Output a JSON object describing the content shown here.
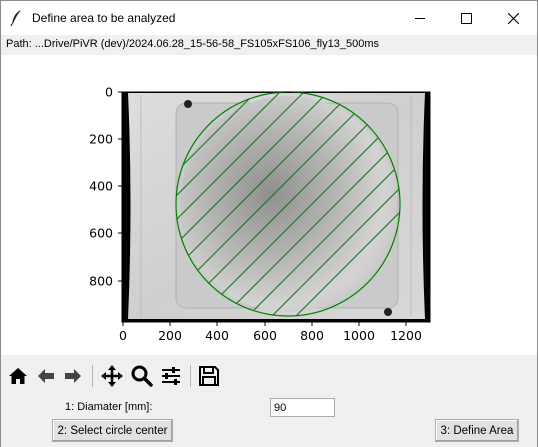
{
  "window": {
    "title": "Define area to be analyzed",
    "path": "Path: ...Drive/PiVR (dev)/2024.06.28_15-56-58_FS105xFS106_fly13_500ms"
  },
  "plot": {
    "x_ticks": [
      "0",
      "200",
      "400",
      "600",
      "800",
      "1000",
      "1200"
    ],
    "y_ticks": [
      "0",
      "200",
      "400",
      "600",
      "800"
    ],
    "circle_color": "#008000"
  },
  "toolbar": {
    "icons": [
      "home-icon",
      "back-icon",
      "forward-icon",
      "pan-icon",
      "zoom-icon",
      "configure-subplots-icon",
      "save-icon"
    ]
  },
  "controls": {
    "diameter_label": "1: Diamater [mm]:",
    "diameter_value": "90",
    "select_center_label": "2: Select circle center",
    "define_area_label": "3: Define Area"
  }
}
